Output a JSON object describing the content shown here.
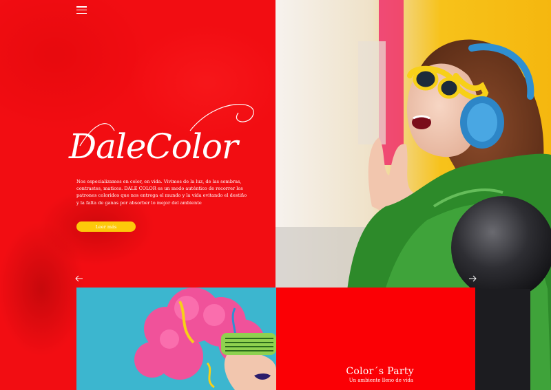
{
  "nav": {
    "menu_icon": "hamburger-icon"
  },
  "hero": {
    "logo": "DaleColor",
    "description": "Nos especializamos en color, en vida. Vivimos de la luz, de las sombras, contrastes, matices. DALE COLOR es un modo auténtico de recorrer los patrones coloridos que nos entrega el mundo y la vida evitando el destiño y la falta de ganas por absorber lo mejor del ambiente",
    "read_more_label": "Leer más",
    "prev_icon": "arrow-left-icon",
    "next_icon": "arrow-right-icon"
  },
  "cards": {
    "party": {
      "title": "Color´s Party",
      "subtitle": "Un ambiente lleno de vida"
    }
  },
  "colors": {
    "brand_red": "#f20d12",
    "accent_yellow": "#fdc90a",
    "card_red": "#fb0005"
  }
}
